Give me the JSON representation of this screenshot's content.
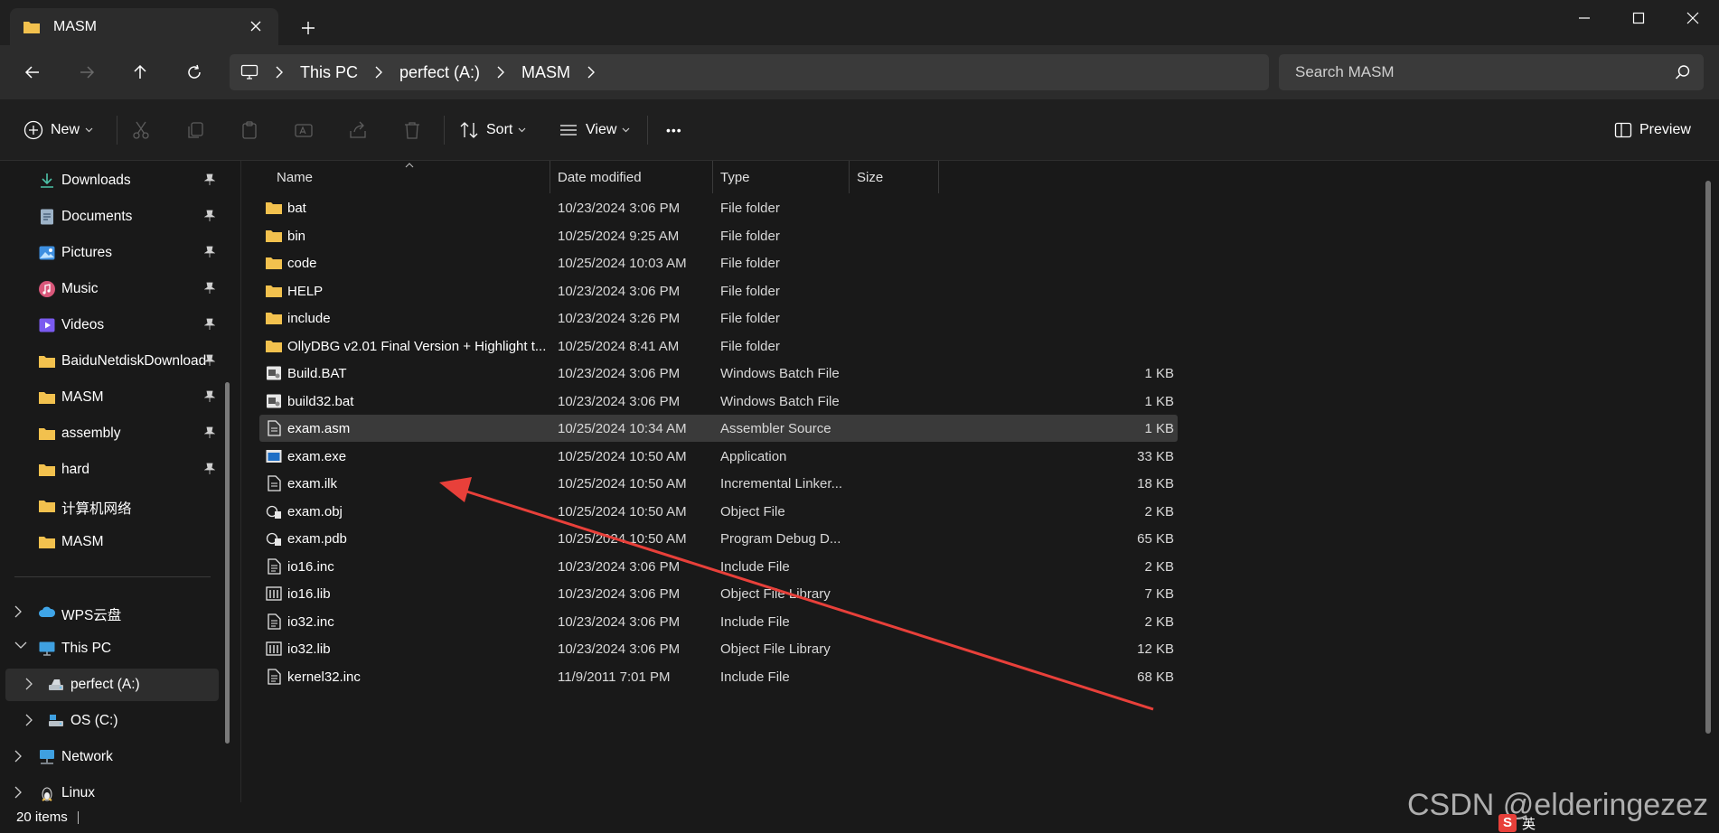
{
  "window": {
    "tab_title": "MASM",
    "new_tab_glyph": "+",
    "close_tab_glyph": "✕",
    "controls": {
      "minimize": "—",
      "maximize": "□",
      "close": "✕"
    }
  },
  "address": {
    "breadcrumbs": [
      "This PC",
      "perfect (A:)",
      "MASM"
    ],
    "search_placeholder": "Search MASM"
  },
  "toolbar": {
    "new_label": "New",
    "sort_label": "Sort",
    "view_label": "View",
    "more_glyph": "•••",
    "preview_label": "Preview"
  },
  "sidebar": {
    "quick_access": [
      {
        "label": "Downloads",
        "icon": "download-icon",
        "pinned": true
      },
      {
        "label": "Documents",
        "icon": "documents-icon",
        "pinned": true
      },
      {
        "label": "Pictures",
        "icon": "pictures-icon",
        "pinned": true
      },
      {
        "label": "Music",
        "icon": "music-icon",
        "pinned": true
      },
      {
        "label": "Videos",
        "icon": "videos-icon",
        "pinned": true
      },
      {
        "label": "BaiduNetdiskDownload",
        "icon": "folder-icon",
        "pinned": true
      },
      {
        "label": "MASM",
        "icon": "folder-icon",
        "pinned": true
      },
      {
        "label": "assembly",
        "icon": "folder-icon",
        "pinned": true
      },
      {
        "label": "hard",
        "icon": "folder-icon",
        "pinned": true
      },
      {
        "label": "计算机网络",
        "icon": "folder-icon",
        "pinned": false
      },
      {
        "label": "MASM",
        "icon": "folder-icon",
        "pinned": false
      }
    ],
    "tree": [
      {
        "label": "WPS云盘",
        "icon": "cloud-icon",
        "expanded": false
      },
      {
        "label": "This PC",
        "icon": "computer-icon",
        "expanded": true
      },
      {
        "label": "perfect (A:)",
        "icon": "drive-icon",
        "expanded": false,
        "selected": true
      },
      {
        "label": "OS (C:)",
        "icon": "drive-icon",
        "expanded": false
      },
      {
        "label": "Network",
        "icon": "network-icon",
        "expanded": false
      },
      {
        "label": "Linux",
        "icon": "linux-icon",
        "expanded": false
      }
    ]
  },
  "columns": {
    "name": "Name",
    "date": "Date modified",
    "type": "Type",
    "size": "Size"
  },
  "files": [
    {
      "name": "bat",
      "date": "10/23/2024 3:06 PM",
      "type": "File folder",
      "size": "",
      "icon": "folder"
    },
    {
      "name": "bin",
      "date": "10/25/2024 9:25 AM",
      "type": "File folder",
      "size": "",
      "icon": "folder"
    },
    {
      "name": "code",
      "date": "10/25/2024 10:03 AM",
      "type": "File folder",
      "size": "",
      "icon": "folder"
    },
    {
      "name": "HELP",
      "date": "10/23/2024 3:06 PM",
      "type": "File folder",
      "size": "",
      "icon": "folder"
    },
    {
      "name": "include",
      "date": "10/23/2024 3:26 PM",
      "type": "File folder",
      "size": "",
      "icon": "folder"
    },
    {
      "name": "OllyDBG v2.01 Final Version + Highlight t...",
      "date": "10/25/2024 8:41 AM",
      "type": "File folder",
      "size": "",
      "icon": "folder"
    },
    {
      "name": "Build.BAT",
      "date": "10/23/2024 3:06 PM",
      "type": "Windows Batch File",
      "size": "1 KB",
      "icon": "batch"
    },
    {
      "name": "build32.bat",
      "date": "10/23/2024 3:06 PM",
      "type": "Windows Batch File",
      "size": "1 KB",
      "icon": "batch"
    },
    {
      "name": "exam.asm",
      "date": "10/25/2024 10:34 AM",
      "type": "Assembler Source",
      "size": "1 KB",
      "icon": "document",
      "selected": true
    },
    {
      "name": "exam.exe",
      "date": "10/25/2024 10:50 AM",
      "type": "Application",
      "size": "33 KB",
      "icon": "app"
    },
    {
      "name": "exam.ilk",
      "date": "10/25/2024 10:50 AM",
      "type": "Incremental Linker...",
      "size": "18 KB",
      "icon": "document"
    },
    {
      "name": "exam.obj",
      "date": "10/25/2024 10:50 AM",
      "type": "Object File",
      "size": "2 KB",
      "icon": "object"
    },
    {
      "name": "exam.pdb",
      "date": "10/25/2024 10:50 AM",
      "type": "Program Debug D...",
      "size": "65 KB",
      "icon": "object"
    },
    {
      "name": "io16.inc",
      "date": "10/23/2024 3:06 PM",
      "type": "Include File",
      "size": "2 KB",
      "icon": "text"
    },
    {
      "name": "io16.lib",
      "date": "10/23/2024 3:06 PM",
      "type": "Object File Library",
      "size": "7 KB",
      "icon": "library"
    },
    {
      "name": "io32.inc",
      "date": "10/23/2024 3:06 PM",
      "type": "Include File",
      "size": "2 KB",
      "icon": "text"
    },
    {
      "name": "io32.lib",
      "date": "10/23/2024 3:06 PM",
      "type": "Object File Library",
      "size": "12 KB",
      "icon": "library"
    },
    {
      "name": "kernel32.inc",
      "date": "11/9/2011 7:01 PM",
      "type": "Include File",
      "size": "68 KB",
      "icon": "text"
    }
  ],
  "status": {
    "item_count": "20 items"
  },
  "watermark": "CSDN @elderingezez",
  "ime": {
    "lang": "英"
  },
  "colors": {
    "folder": "#f2c14e",
    "arrow": "#e8403a",
    "accent": "#4cc2ff"
  }
}
